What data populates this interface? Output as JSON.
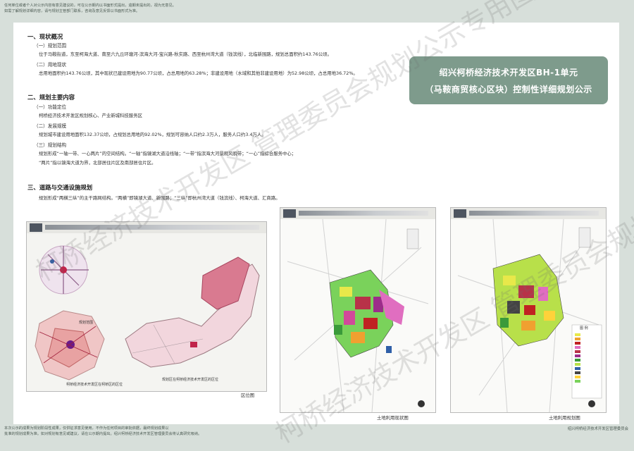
{
  "top_notice": [
    "任何单位或者个人对公示内容有意见建议的，可在公示期内以书面形式提出，逾期未提出的，视为无意见。",
    "如需了解规划详细内容，请与规划主管部门联系，咨询及意见反馈以书面形式为准。"
  ],
  "title": {
    "line1": "绍兴柯桥经济技术开发区BH-1单元",
    "line2": "（马鞍商贸核心区块）控制性详细规划公示"
  },
  "sections": {
    "s1": {
      "heading": "一、现状概况",
      "sub1": "（一）规划范围",
      "sub1_text": "位于马鞍街道，东至柯海大道、南至六九丘环塘河-滨海大河-宝兴路-秋实路、西至杭州湾大道（钱滨线），北临新围路，规划总面积约143.76公顷。",
      "sub2": "（二）用地现状",
      "sub2_text": "总用地面积约143.76公顷，其中现状已建设用地为90.77公顷，占总用地的63.28%；非建设用地（水域和其他非建设用地）为52.98公顷，占总用地36.72%。"
    },
    "s2": {
      "heading": "二、规划主要内容",
      "sub1": "（一）功能定位",
      "sub1_text": "柯桥经济技术开发区规划核心、产业新城科技服务区",
      "sub2": "（二）发展规模",
      "sub2_text": "规划城市建设用地面积132.37公顷，占规划总用地的92.02%，规划可容纳人口约2.3万人，服务人口约3.4万人。",
      "sub3": "（三）规划结构",
      "sub3_text1": "规划形成“一轴一带、一心两片”的空间结构。“一轴”指镜湖大道沿线轴；“一带”指滨海大河景观风貌带；“一心”指综合服务中心；",
      "sub3_text2": "“两片”指以镜海大道为界，北部居住片区及南部居住片区。"
    },
    "s3": {
      "heading": "三、道路与交通设施规划",
      "text": "规划形成“两横三纵”的主干路网结构。“两横”即镜湖大道、新围路；“三纵”即杭州湾大道（钱滨线）、柯海大道、汇商路。"
    }
  },
  "figures": {
    "location_map": {
      "caption": "区位图",
      "legend1": "规划范围",
      "legend2": "规划区在柯桥经济技术开发区的区位",
      "legend3": "柯桥经济技术开发区在柯桥区的区位"
    },
    "current_landuse": {
      "caption": "土地利用现状图"
    },
    "planned_landuse": {
      "caption": "土地利用规划图",
      "legend_title": "图 例"
    }
  },
  "bottom_notice": [
    "本次公示的成果为规划阶段性成果，仅供征求意见使用，不作为任何项目的审批依据，最终规划成果以",
    "批准的规划成果为准。如对规划有意见或建议，请在公示期内提出。绍兴柯桥经济技术开发区管理委员会将认真研究吸纳。"
  ],
  "bottom_org": "绍兴柯桥经济技术开发区管理委员会",
  "watermark_text": "柯桥经济技术开发区 管理委员会规划公示专用图件",
  "colors": {
    "title_bg": "#7e9b8c",
    "page_bg": "#d7dfda"
  }
}
